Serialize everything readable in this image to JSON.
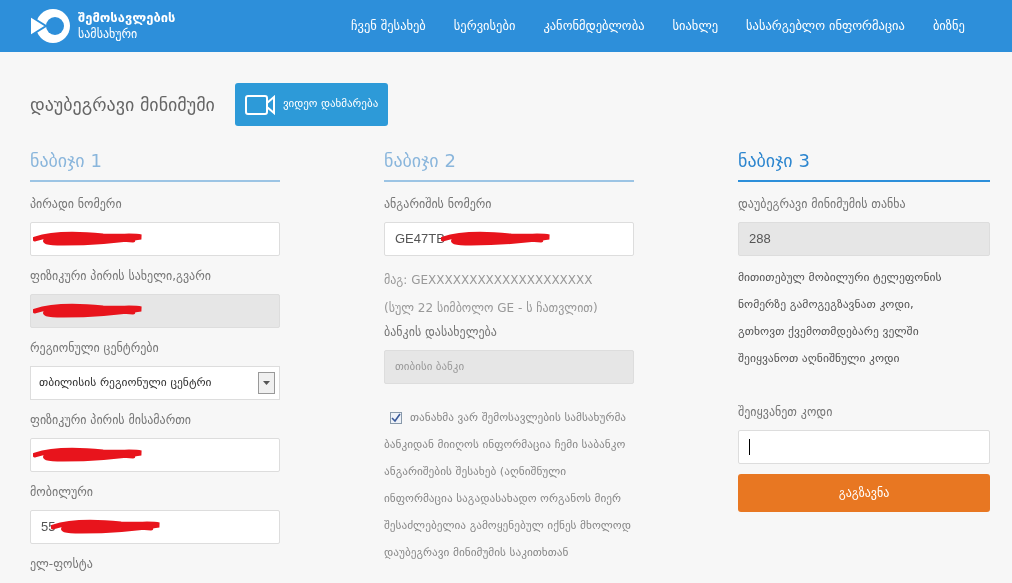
{
  "logo": {
    "line1": "შემოსავლების",
    "line2": "სამსახური"
  },
  "nav": [
    "ჩვენ შესახებ",
    "სერვისები",
    "კანონმდებლობა",
    "სიახლე",
    "სასარგებლო ინფორმაცია",
    "ბიზნე"
  ],
  "page_title": "დაუბეგრავი მინიმუმი",
  "video_button": "ვიდეო დახმარება",
  "steps": [
    {
      "title": "ნაბიჯი 1",
      "active": false,
      "fields": [
        {
          "kind": "input",
          "label": "პირადი ნომერი",
          "redacted": true,
          "disabled": false
        },
        {
          "kind": "input",
          "label": "ფიზიკური პირის სახელი,გვარი",
          "redacted": true,
          "disabled": true
        },
        {
          "kind": "select",
          "label": "რეგიონული ცენტრები",
          "value": "თბილისის რეგიონული ცენტრი"
        },
        {
          "kind": "input",
          "label": "ფიზიკური პირის მისამართი",
          "redacted": true,
          "disabled": false
        },
        {
          "kind": "input",
          "label": "მობილური",
          "value": "55",
          "redacted": true,
          "disabled": false
        },
        {
          "kind": "label",
          "label": "ელ-ფოსტა"
        }
      ]
    },
    {
      "title": "ნაბიჯი 2",
      "active": false,
      "fields": [
        {
          "kind": "input",
          "label": "ანგარიშის ნომერი",
          "value": "GE47TB",
          "redacted": true,
          "disabled": false
        },
        {
          "kind": "note",
          "label": "მაგ: GEXXXXXXXXXXXXXXXXXXXX"
        },
        {
          "kind": "note",
          "label": "(სულ 22 სიმბოლო GE - ს ჩათვლით)"
        },
        {
          "kind": "input",
          "label": "ბანკის დასახელება",
          "placeholder": "თიბისი ბანკი",
          "disabled": true
        },
        {
          "kind": "checkbox",
          "label": "თანახმა ვარ შემოსავლების სამსახურმა ბანკიდან მიიღოს ინფორმაცია ჩემი საბანკო ანგარიშების შესახებ (აღნიშნული ინფორმაცია საგადასახადო ორგანოს მიერ შესაძლებელია გამოყენებულ იქნეს მხოლოდ დაუბეგრავი მინიმუმის საკითხთან",
          "checked": true
        }
      ]
    },
    {
      "title": "ნაბიჯი 3",
      "active": true,
      "fields": [
        {
          "kind": "input",
          "label": "დაუბეგრავი მინიმუმის თანხა",
          "value": "288",
          "disabled": true
        },
        {
          "kind": "paragraph",
          "label": "მითითებულ მობილური ტელეფონის ნომერზე გამოგეგზავნათ კოდი, გთხოვთ ქვემოთმდებარე ველში შეიყვანოთ აღნიშნული კოდი"
        },
        {
          "kind": "input",
          "label": "შეიყვანეთ კოდი",
          "disabled": false,
          "focused": true
        },
        {
          "kind": "button",
          "label": "გაგზავნა"
        }
      ]
    }
  ]
}
